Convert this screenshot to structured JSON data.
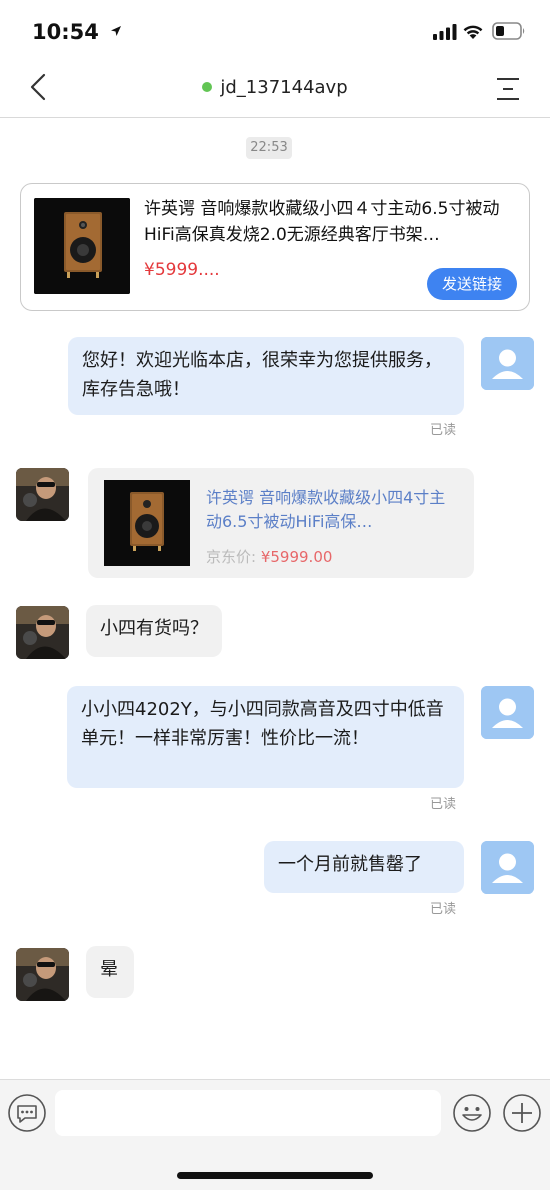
{
  "status_bar": {
    "time": "10:54"
  },
  "nav": {
    "title": "jd_137144avp"
  },
  "chat": {
    "timestamp": "22:53",
    "product_card": {
      "title": "许英谔 音响爆款收藏级小四４寸主动6.5寸被动HiFi高保真发烧2.0无源经典客厅书架…",
      "price": "¥5999....",
      "send_button": "发送链接"
    },
    "messages": [
      {
        "text": "您好！欢迎光临本店，很荣幸为您提供服务，库存告急哦！",
        "read": "已读"
      },
      {
        "text": "小四有货吗？"
      },
      {
        "text": "小小四4202Y，与小四同款高音及四寸中低音单元！一样非常厉害！性价比一流！",
        "read": "已读"
      },
      {
        "text": "一个月前就售罄了",
        "read": "已读"
      },
      {
        "text": "晕"
      }
    ],
    "shared_product": {
      "title": "许英谔 音响爆款收藏级小四4寸主动6.5寸被动HiFi高保…",
      "price_label": "京东价: ",
      "price": "¥5999.00"
    }
  },
  "input_bar": {
    "placeholder": ""
  },
  "colors": {
    "accent": "#3e83f1",
    "price_red": "#e4393c",
    "online_green": "#62c554",
    "bubble_blue": "#e3edfb",
    "bubble_gray": "#f1f1f1",
    "avatar_blue": "#9ec7f3"
  },
  "icons": [
    "location-arrow-icon",
    "signal-icon",
    "wifi-icon",
    "battery-icon",
    "back-icon",
    "menu-icon",
    "keyboard-icon",
    "emoji-icon",
    "plus-icon",
    "default-avatar-icon"
  ]
}
